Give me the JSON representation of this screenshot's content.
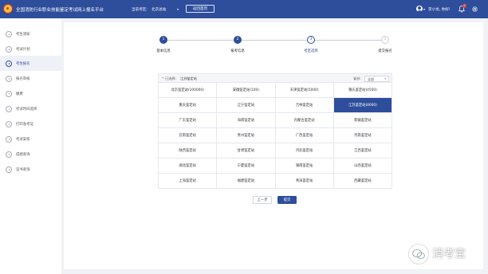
{
  "header": {
    "site_title": "全国消防行业职业技能鉴定考试网上报名平台",
    "region_label": "当前考区:",
    "region_value": "北京总站",
    "home_button": "返回首页",
    "greeting": "李小龙, 你好!",
    "notification_count": "0"
  },
  "sidebar": {
    "items": [
      {
        "label": "考生须知",
        "icon": "info-icon"
      },
      {
        "label": "考试计划",
        "icon": "calendar-icon"
      },
      {
        "label": "考生报名",
        "icon": "register-icon",
        "active": true
      },
      {
        "label": "报名审核",
        "icon": "review-icon"
      },
      {
        "label": "缴费",
        "icon": "payment-icon"
      },
      {
        "label": "考试时间选择",
        "icon": "clock-icon"
      },
      {
        "label": "打印准考证",
        "icon": "print-icon"
      },
      {
        "label": "考试安排",
        "icon": "schedule-icon"
      },
      {
        "label": "成绩查询",
        "icon": "score-icon"
      },
      {
        "label": "证书查询",
        "icon": "certificate-icon"
      }
    ]
  },
  "steps": [
    {
      "number": "1",
      "label": "基本信息",
      "state": "done"
    },
    {
      "number": "2",
      "label": "报考信息",
      "state": "done"
    },
    {
      "number": "3",
      "label": "考区选择",
      "state": "current"
    },
    {
      "number": "4",
      "label": "提交报名",
      "state": "todo"
    }
  ],
  "filter": {
    "required_mark": "*",
    "selected_label": "已选择:",
    "selected_value": "江苏鉴定站",
    "province_label": "省份:",
    "province_value": "全部"
  },
  "stations": [
    [
      "北京鉴定站(100000)",
      "安徽鉴定站(100)",
      "天津鉴定站(5000)",
      "重庆鉴定站(4500)"
    ],
    [
      "重庆鉴定站",
      "辽宁鉴定站",
      "吉林鉴定站",
      "江苏鉴定站(8000)"
    ],
    [
      "广东鉴定站",
      "海南鉴定站",
      "内蒙古鉴定站",
      "新疆鉴定站"
    ],
    [
      "云南鉴定站",
      "贵州鉴定站",
      "广西鉴定站",
      "河南鉴定站"
    ],
    [
      "陕西鉴定站",
      "甘肃鉴定站",
      "河北鉴定站",
      "江西鉴定站"
    ],
    [
      "湖北鉴定站",
      "宁夏鉴定站",
      "湖南鉴定站",
      "山西鉴定站"
    ],
    [
      "上海鉴定站",
      "福建鉴定站",
      "青海鉴定站",
      "西藏鉴定站"
    ]
  ],
  "selected_station": "江苏鉴定站(8000)",
  "buttons": {
    "prev": "上一步",
    "submit": "提交"
  },
  "watermark": {
    "text": "消考宝"
  },
  "colors": {
    "primary": "#2e4e9c",
    "header_bg": "#2e4e9c",
    "danger": "#e23b3b"
  }
}
